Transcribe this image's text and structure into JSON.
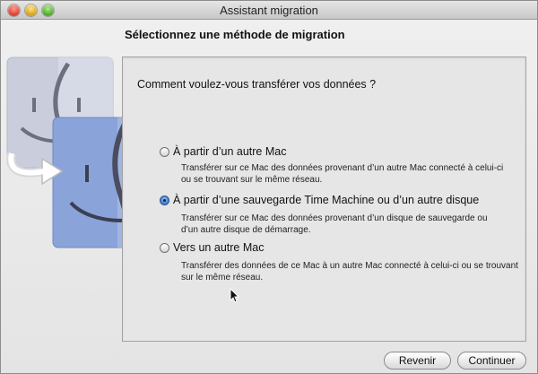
{
  "window": {
    "title": "Assistant migration"
  },
  "page": {
    "heading": "Sélectionnez une méthode de migration",
    "question": "Comment voulez-vous transférer vos données ?"
  },
  "options": [
    {
      "label": "À partir d’un autre Mac",
      "description_line1": "Transférer sur ce Mac des données provenant d’un autre Mac connecté à celui-ci",
      "description_line2": "ou se trouvant sur le même réseau.",
      "selected": false
    },
    {
      "label": "À partir d’une sauvegarde Time Machine ou d’un autre disque",
      "description_line1": "Transférer sur ce Mac des données provenant d’un disque de sauvegarde ou",
      "description_line2": "d’un autre disque de démarrage.",
      "selected": true
    },
    {
      "label": "Vers un autre Mac",
      "description_line1": "Transférer des données de ce Mac à un autre Mac connecté à celui-ci ou se trouvant",
      "description_line2": "sur le même réseau.",
      "selected": false
    }
  ],
  "buttons": {
    "back": "Revenir",
    "continue": "Continuer"
  },
  "icons": {
    "finder_left": "finder-face-icon",
    "finder_right": "finder-face-icon",
    "transfer_arrow": "curved-arrow-icon",
    "window_controls": [
      "close-icon",
      "minimize-icon",
      "zoom-icon"
    ]
  },
  "colors": {
    "finder_back_face": "#c9cddc",
    "finder_front_face": "#8aa3d9",
    "radio_selected": "#2f72c8"
  }
}
